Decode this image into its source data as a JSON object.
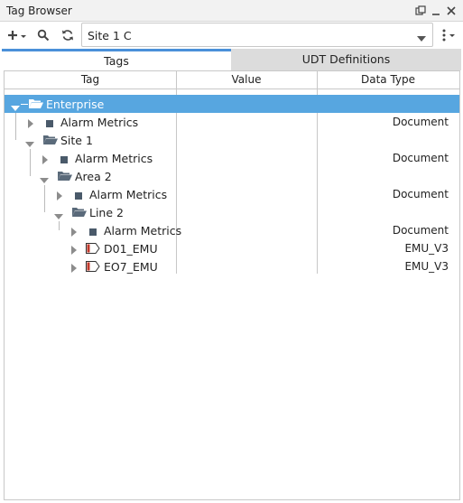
{
  "window": {
    "title": "Tag Browser"
  },
  "provider": {
    "selected": "Site 1 C"
  },
  "tabs": [
    {
      "label": "Tags",
      "active": true
    },
    {
      "label": "UDT Definitions",
      "active": false
    }
  ],
  "columns": {
    "tag": "Tag",
    "value": "Value",
    "data_type": "Data Type"
  },
  "rows": [
    {
      "name": "Enterprise",
      "value": "",
      "data_type": "",
      "icon": "folder-open-icon",
      "expanded": true,
      "selected": true
    },
    {
      "name": "Alarm Metrics",
      "value": "",
      "data_type": "Document",
      "icon": "document-tag-icon",
      "expanded": false
    },
    {
      "name": "Site 1",
      "value": "",
      "data_type": "",
      "icon": "folder-open-icon",
      "expanded": true
    },
    {
      "name": "Alarm Metrics",
      "value": "",
      "data_type": "Document",
      "icon": "document-tag-icon",
      "expanded": false
    },
    {
      "name": "Area 2",
      "value": "",
      "data_type": "",
      "icon": "folder-open-icon",
      "expanded": true
    },
    {
      "name": "Alarm Metrics",
      "value": "",
      "data_type": "Document",
      "icon": "document-tag-icon",
      "expanded": false
    },
    {
      "name": "Line 2",
      "value": "",
      "data_type": "",
      "icon": "folder-open-icon",
      "expanded": true
    },
    {
      "name": "Alarm Metrics",
      "value": "",
      "data_type": "Document",
      "icon": "document-tag-icon",
      "expanded": false
    },
    {
      "name": "D01_EMU",
      "value": "",
      "data_type": "EMU_V3",
      "icon": "udt-instance-icon",
      "expanded": false
    },
    {
      "name": "EO7_EMU",
      "value": "",
      "data_type": "EMU_V3",
      "icon": "udt-instance-icon",
      "expanded": false
    }
  ]
}
